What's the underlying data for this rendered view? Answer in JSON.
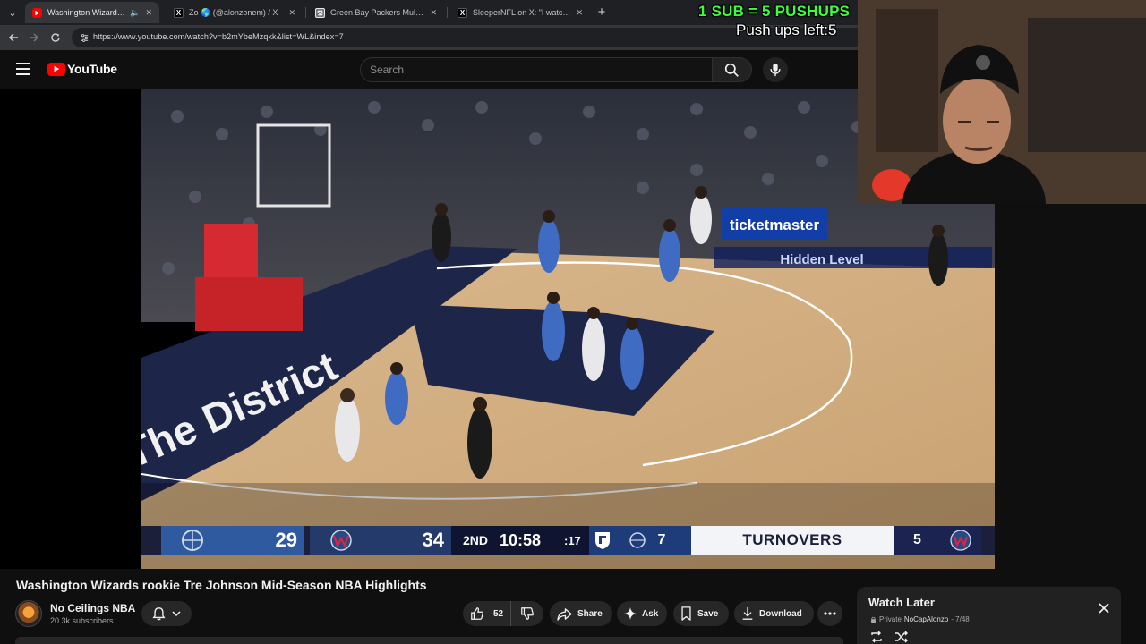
{
  "browser": {
    "tabs": [
      {
        "title": "Washington Wizards rookie Tre Johnson Mid-Season NBA Highlights",
        "favicon": "youtube-favicon",
        "active": true,
        "audio": true
      },
      {
        "title": "Zo 🌎 (@alonzonem) / X",
        "favicon": "x-favicon",
        "active": false
      },
      {
        "title": "Green Bay Packers Multi-Year Tr",
        "favicon": "site-favicon",
        "active": false
      },
      {
        "title": "SleeperNFL on X: \"I watch the",
        "favicon": "x-favicon",
        "active": false
      }
    ],
    "url": "https://www.youtube.com/watch?v=b2mYbeMzqkk&list=WL&index=7"
  },
  "youtube": {
    "logo_text": "YouTube",
    "search_placeholder": "Search"
  },
  "overlay": {
    "headline": "1 SUB = 5 PUSHUPS",
    "counter": "Push ups left:5"
  },
  "scorebug": {
    "away_score": "29",
    "home_score": "34",
    "period": "2ND",
    "clock": "10:58",
    "shot_clock": ":17",
    "away_stat": "7",
    "stat_label": "TURNOVERS",
    "home_stat": "5",
    "colors": {
      "away": "#2f5aa0",
      "home": "#233a6a",
      "bar": "#1b1f3a"
    }
  },
  "scene": {
    "arena_sign": "ticketmaster",
    "arena_sign_2": "Hidden Level",
    "baseline_text": "The District"
  },
  "video": {
    "title": "Washington Wizards rookie Tre Johnson Mid-Season NBA Highlights",
    "channel_name": "No Ceilings NBA",
    "subscribers": "20.3k subscribers",
    "likes": "52",
    "actions": {
      "share": "Share",
      "ask": "Ask",
      "save": "Save",
      "download": "Download"
    }
  },
  "playlist": {
    "title": "Watch Later",
    "privacy": "Private",
    "owner": "NoCapAlonzo",
    "position": "- 7/48"
  }
}
